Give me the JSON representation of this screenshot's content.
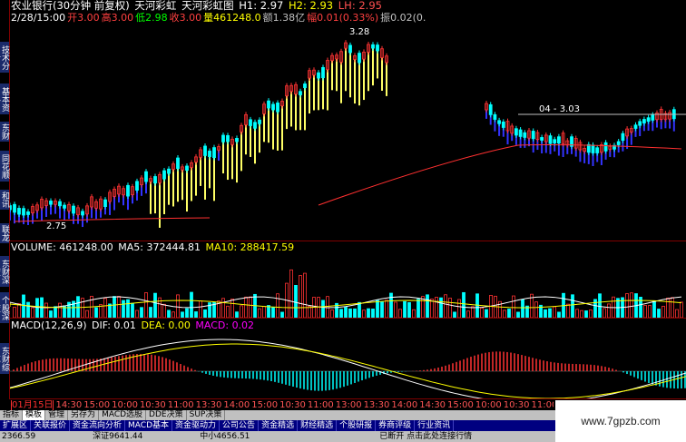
{
  "sidebar": {
    "tabs": [
      {
        "label": "技术分析"
      },
      {
        "label": "基本资料"
      },
      {
        "label": "东财"
      },
      {
        "label": "同花顺"
      },
      {
        "label": "和讯"
      },
      {
        "label": "联龙"
      }
    ],
    "tab_labels_lower": [
      "东财深度",
      "个股深度",
      "东财综艺"
    ]
  },
  "header": {
    "title": "农业银行(30分钟 前复权)",
    "indicator1": "天河彩虹",
    "indicator2": "天河彩虹图",
    "h1": "H1: 2.97",
    "h2": "H2: 2.93",
    "lh": "LH: 2.95"
  },
  "info_line": {
    "datetime": "2/28/15:00",
    "open": "开3.00",
    "high": "高3.00",
    "low": "低2.98",
    "close": "收3.00",
    "volume": "量461248.0",
    "amount": "额1.38亿",
    "change": "幅0.01(0.33%)",
    "amp": "振0.02(0."
  },
  "price_labels": {
    "peak": "3.28",
    "right_level": "04 - 3.03",
    "low": "2.75"
  },
  "volume_header": {
    "volume": "VOLUME: 461248.00",
    "ma5": "MA5: 372444.81",
    "ma10": "MA10: 288417.59"
  },
  "macd_header": {
    "name": "MACD(12,26,9)",
    "dif": "DIF: 0.01",
    "dea": "DEA: 0.00",
    "macd": "MACD: 0.02"
  },
  "time_axis": {
    "labels": [
      "01月15日",
      "14:30",
      "15:00",
      "10:00",
      "10:30",
      "11:00",
      "13:30",
      "14:00",
      "15:00",
      "10:30",
      "11:00",
      "13:00",
      "13:30",
      "14:00",
      "14:30",
      "15:00",
      "10:00",
      "10:30",
      "11:00",
      "13:30",
      "14:00",
      "14:30",
      "15:00",
      "10:00",
      "13:00",
      "14:00",
      "15:00",
      "10:00",
      "10:30",
      "13:30",
      "14:00",
      "14:30",
      "15:00"
    ]
  },
  "bottom_tabs": [
    "指标",
    "模板",
    "管理",
    "另存为",
    "MACD选股",
    "DDE决策",
    "SUP决策"
  ],
  "nav_tabs": [
    "扩展区",
    "关联报价",
    "资金流向分析",
    "MACD基本",
    "资金驱动力",
    "公司公告",
    "资金精选",
    "财经精选",
    "个股研报",
    "券商评级",
    "行业资讯"
  ],
  "status": {
    "left_index": "2366.59",
    "mid_index": "深证9641.44",
    "mid2": "中小4656.51",
    "right": "已断开   点击此处连接行情"
  },
  "watermark": "www.7gpzb.com",
  "colors": {
    "up": "#ff3333",
    "down": "#00ffff",
    "rainbow_up": "#ffff66",
    "rainbow_down": "#3333ff",
    "ma_red": "#ff3030",
    "grid": "#800000",
    "dif": "#ffffff",
    "dea": "#ffff00",
    "macd_label": "#ff00ff"
  }
}
